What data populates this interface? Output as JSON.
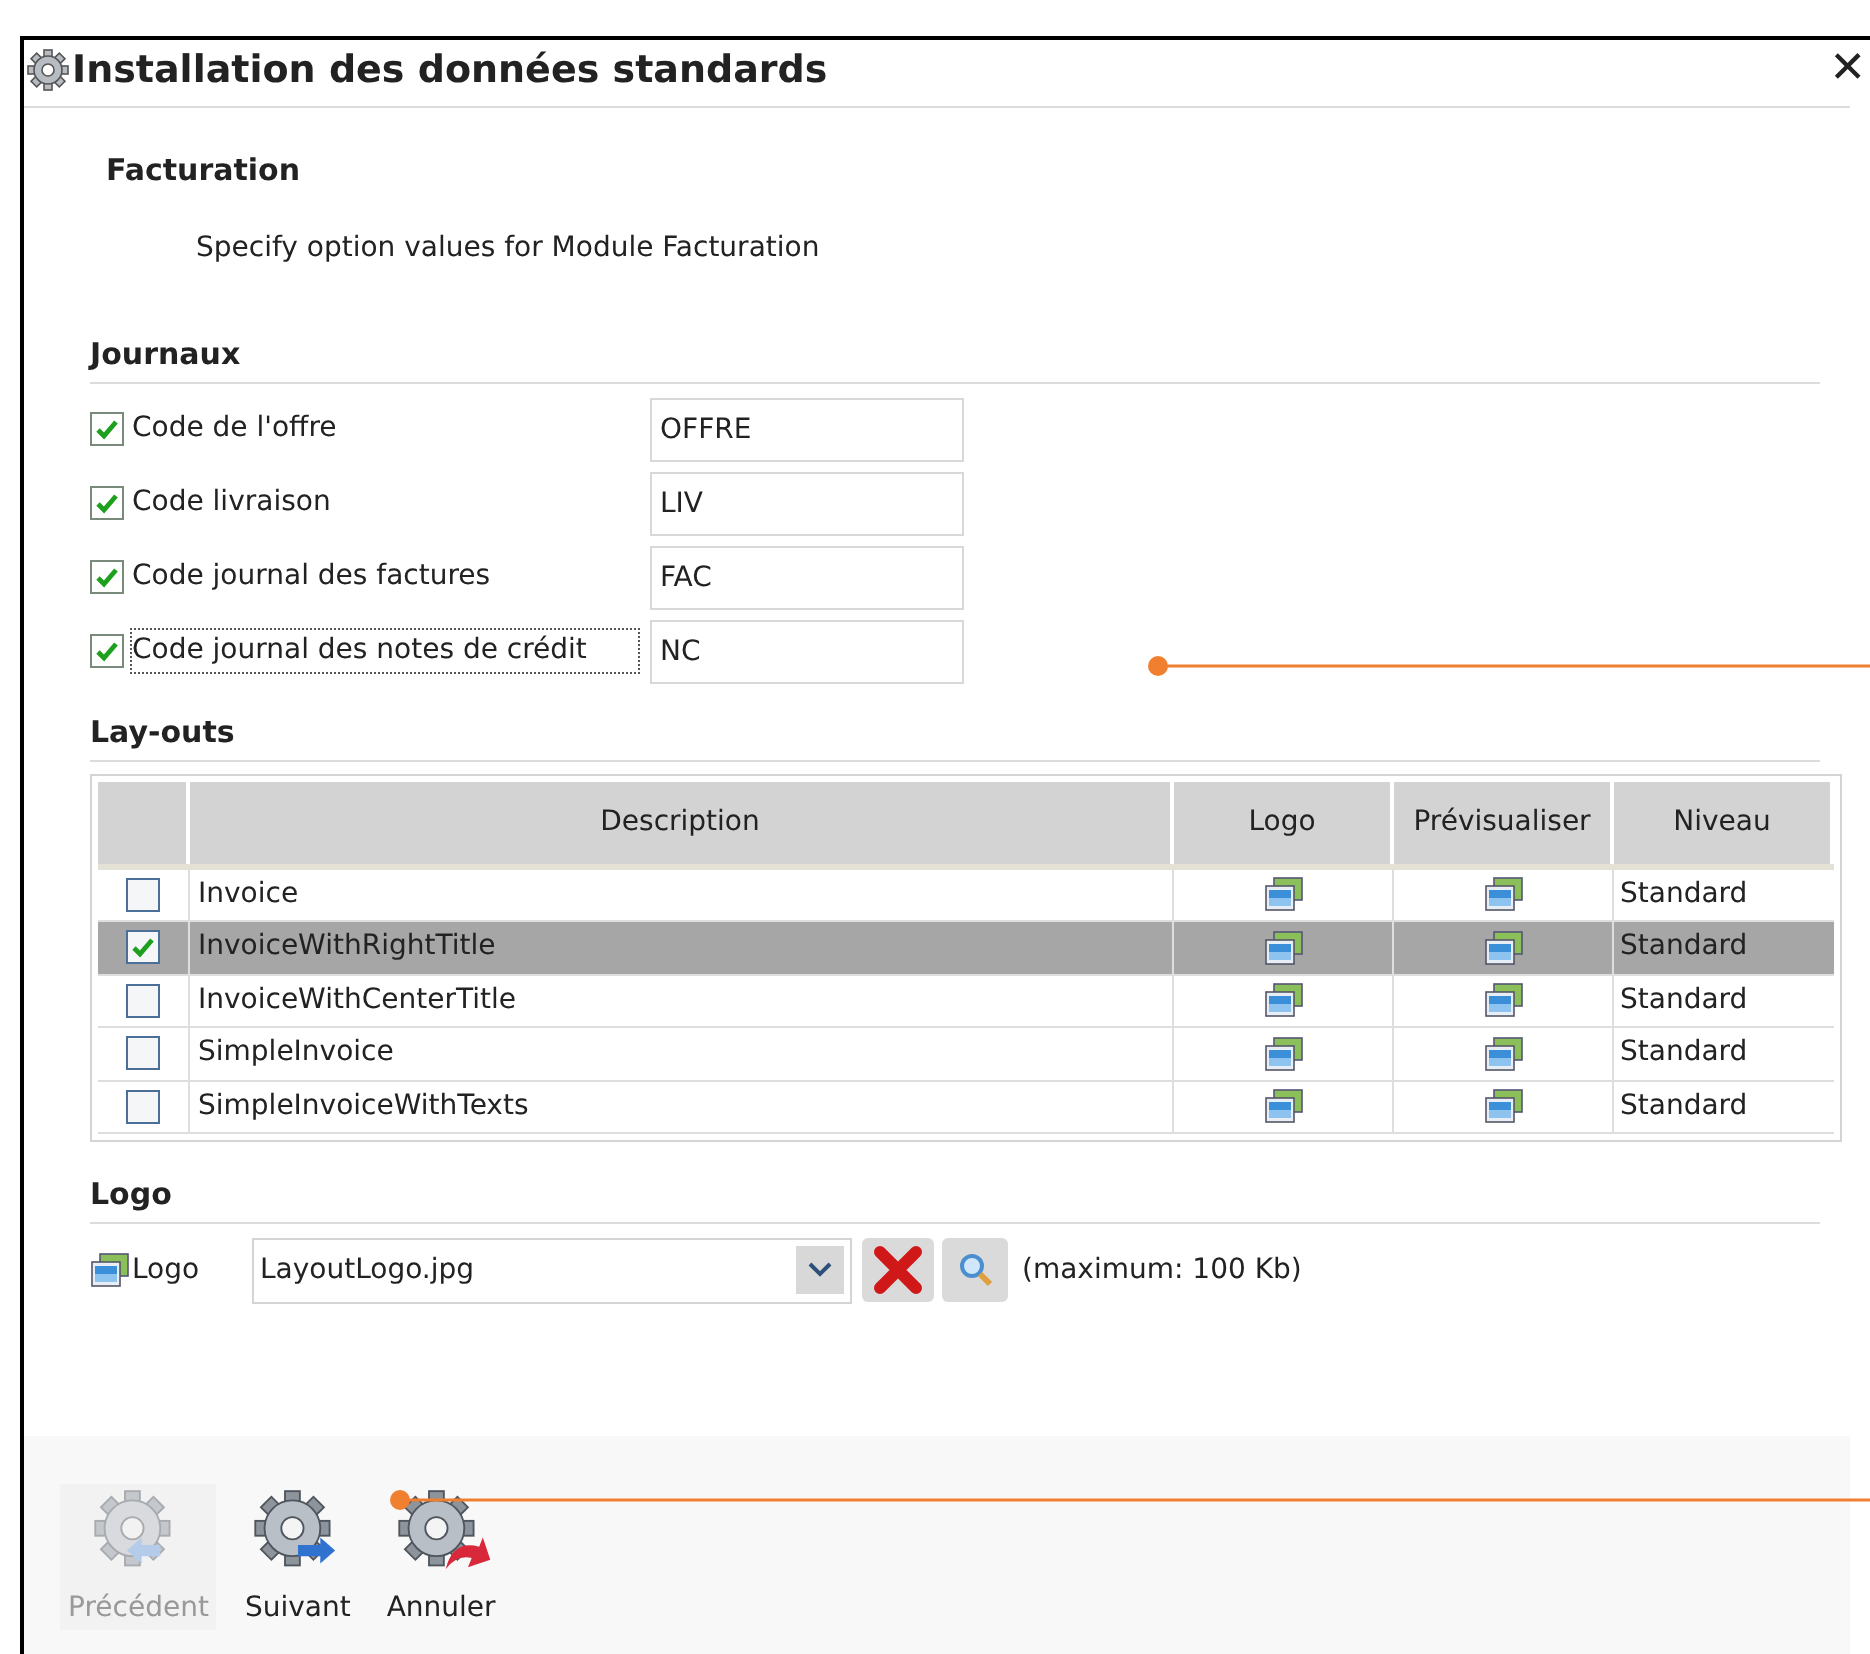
{
  "window": {
    "title": "Installation des données standards",
    "close": "✕"
  },
  "header": {
    "title": "Facturation",
    "description": "Specify option values for Module Facturation"
  },
  "journaux": {
    "title": "Journaux",
    "items": [
      {
        "label": "Code de l'offre",
        "checked": true,
        "value": "OFFRE",
        "focused": false
      },
      {
        "label": "Code livraison",
        "checked": true,
        "value": "LIV",
        "focused": false
      },
      {
        "label": "Code journal des factures",
        "checked": true,
        "value": "FAC",
        "focused": false
      },
      {
        "label": "Code journal des notes de crédit",
        "checked": true,
        "value": "NC",
        "focused": true
      }
    ]
  },
  "layouts": {
    "title": "Lay-outs",
    "columns": [
      "Description",
      "Logo",
      "Prévisualiser",
      "Niveau"
    ],
    "rows": [
      {
        "checked": false,
        "selected": false,
        "description": "Invoice",
        "niveau": "Standard"
      },
      {
        "checked": true,
        "selected": true,
        "description": "InvoiceWithRightTitle",
        "niveau": "Standard"
      },
      {
        "checked": false,
        "selected": false,
        "description": "InvoiceWithCenterTitle",
        "niveau": "Standard"
      },
      {
        "checked": false,
        "selected": false,
        "description": "SimpleInvoice",
        "niveau": "Standard"
      },
      {
        "checked": false,
        "selected": false,
        "description": "SimpleInvoiceWithTexts",
        "niveau": "Standard"
      }
    ]
  },
  "logo": {
    "title": "Logo",
    "label": "Logo",
    "value": "LayoutLogo.jpg",
    "hint": "(maximum: 100 Kb)"
  },
  "footer_buttons": [
    {
      "label": "Précédent",
      "kind": "previous",
      "disabled": true
    },
    {
      "label": "Suivant",
      "kind": "next",
      "disabled": false
    },
    {
      "label": "Annuler",
      "kind": "cancel",
      "disabled": false
    }
  ]
}
